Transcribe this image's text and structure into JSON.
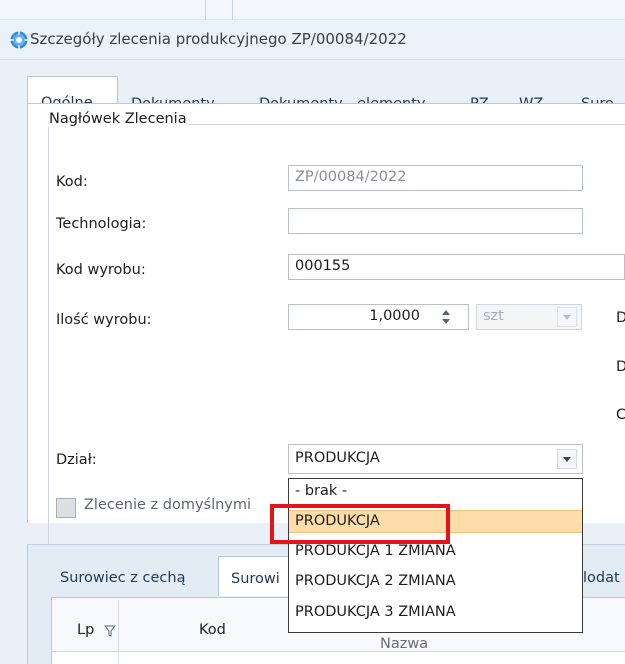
{
  "window": {
    "title": "Szczegóły zlecenia produkcyjnego ZP/00084/2022",
    "colors": {
      "accent_blue": "#3a93dc",
      "highlight": "#ffdca8",
      "callout_red": "#e5131a"
    }
  },
  "tabs": [
    {
      "label": "Ogólne",
      "active": true
    },
    {
      "label": "Dokumenty"
    },
    {
      "label": "Dokumenty - elementy"
    },
    {
      "label": "PZ"
    },
    {
      "label": "WZ"
    },
    {
      "label": "Suro"
    }
  ],
  "header_group": {
    "title": "Nagłówek Zlecenia",
    "kod": {
      "label": "Kod:",
      "value": "ZP/00084/2022"
    },
    "technologia": {
      "label": "Technologia:",
      "value": ""
    },
    "kod_wyrobu": {
      "label": "Kod wyrobu:",
      "value": "000155"
    },
    "ilosc_wyrobu": {
      "label": "Ilość wyrobu:",
      "value": "1,0000",
      "unit": "szt"
    },
    "dzial": {
      "label": "Dział:",
      "value": "PRODUKCJA"
    },
    "side_letters": [
      "D",
      "D",
      "C"
    ]
  },
  "checkbox": {
    "label": "Zlecenie z domyślnymi",
    "checked": false
  },
  "dropdown": {
    "options": [
      "- brak -",
      "PRODUKCJA",
      "PRODUKCJA 1 ZMIANA",
      "PRODUKCJA 2 ZMIANA",
      "PRODUKCJA 3 ZMIANA"
    ],
    "highlighted": "PRODUKCJA"
  },
  "bottom_tabs": [
    {
      "label": "Surowiec z cechą"
    },
    {
      "label": "Surowi",
      "active": true
    },
    {
      "label": "lodat"
    }
  ],
  "grid": {
    "columns": [
      "Lp",
      "Kod",
      "Nazwa"
    ],
    "filter_icon": "filter-icon"
  }
}
